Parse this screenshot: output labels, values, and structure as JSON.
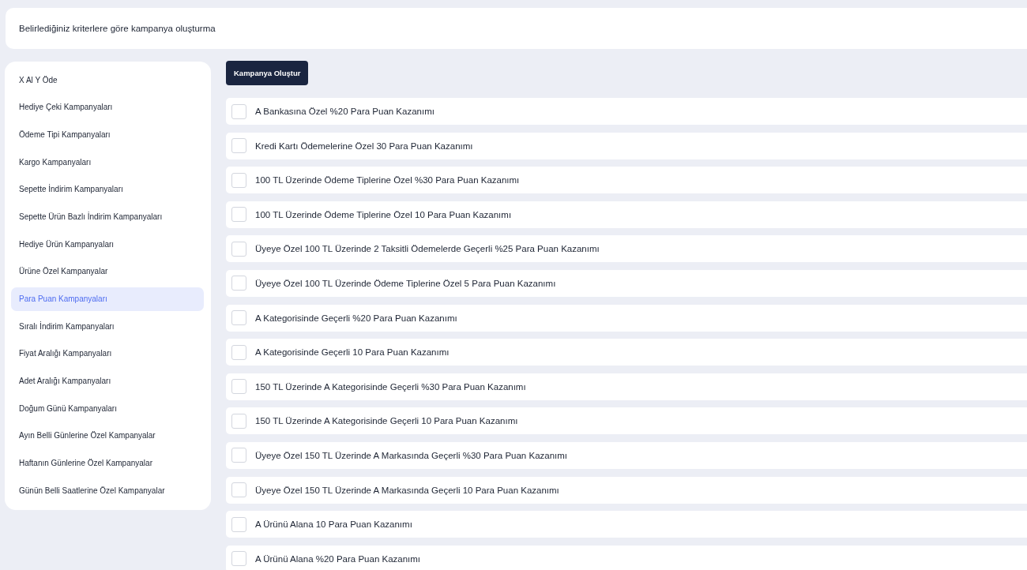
{
  "header": {
    "title": "Belirlediğiniz kriterlere göre kampanya oluşturma"
  },
  "sidebar": {
    "items": [
      {
        "label": "X Al Y Öde",
        "selected": false
      },
      {
        "label": "Hediye Çeki Kampanyaları",
        "selected": false
      },
      {
        "label": "Ödeme Tipi Kampanyaları",
        "selected": false
      },
      {
        "label": "Kargo Kampanyaları",
        "selected": false
      },
      {
        "label": "Sepette İndirim Kampanyaları",
        "selected": false
      },
      {
        "label": "Sepette Ürün Bazlı İndirim Kampanyaları",
        "selected": false
      },
      {
        "label": "Hediye Ürün Kampanyaları",
        "selected": false
      },
      {
        "label": "Ürüne Özel Kampanyalar",
        "selected": false
      },
      {
        "label": "Para Puan Kampanyaları",
        "selected": true
      },
      {
        "label": "Sıralı İndirim Kampanyaları",
        "selected": false
      },
      {
        "label": "Fiyat Aralığı Kampanyaları",
        "selected": false
      },
      {
        "label": "Adet Aralığı Kampanyaları",
        "selected": false
      },
      {
        "label": "Doğum Günü Kampanyaları",
        "selected": false
      },
      {
        "label": "Ayın Belli Günlerine Özel Kampanyalar",
        "selected": false
      },
      {
        "label": "Haftanın Günlerine Özel Kampanyalar",
        "selected": false
      },
      {
        "label": "Günün Belli Saatlerine Özel Kampanyalar",
        "selected": false
      }
    ]
  },
  "create_button": {
    "label": "Kampanya Oluştur"
  },
  "campaigns": [
    {
      "label": "A Bankasına Özel %20 Para Puan Kazanımı",
      "checked": false
    },
    {
      "label": "Kredi Kartı Ödemelerine Özel 30 Para Puan Kazanımı",
      "checked": false
    },
    {
      "label": "100 TL Üzerinde Ödeme Tiplerine Özel %30 Para Puan Kazanımı",
      "checked": false
    },
    {
      "label": "100 TL Üzerinde Ödeme Tiplerine Özel 10 Para Puan Kazanımı",
      "checked": false
    },
    {
      "label": "Üyeye Özel 100 TL Üzerinde 2 Taksitli Ödemelerde Geçerli %25 Para Puan Kazanımı",
      "checked": false
    },
    {
      "label": "Üyeye Özel 100 TL Üzerinde Ödeme Tiplerine Özel 5 Para Puan Kazanımı",
      "checked": false
    },
    {
      "label": "A Kategorisinde Geçerli %20 Para Puan Kazanımı",
      "checked": false
    },
    {
      "label": "A Kategorisinde Geçerli 10 Para Puan Kazanımı",
      "checked": false
    },
    {
      "label": "150 TL Üzerinde A Kategorisinde Geçerli %30 Para Puan Kazanımı",
      "checked": false
    },
    {
      "label": "150 TL Üzerinde A Kategorisinde Geçerli 10 Para Puan Kazanımı",
      "checked": false
    },
    {
      "label": "Üyeye Özel 150 TL Üzerinde A Markasında Geçerli %30 Para Puan Kazanımı",
      "checked": false
    },
    {
      "label": "Üyeye Özel 150 TL Üzerinde A Markasında Geçerli 10 Para Puan Kazanımı",
      "checked": false
    },
    {
      "label": "A Ürünü Alana 10 Para Puan Kazanımı",
      "checked": false
    },
    {
      "label": "A Ürünü Alana %20 Para Puan Kazanımı",
      "checked": false
    }
  ]
}
